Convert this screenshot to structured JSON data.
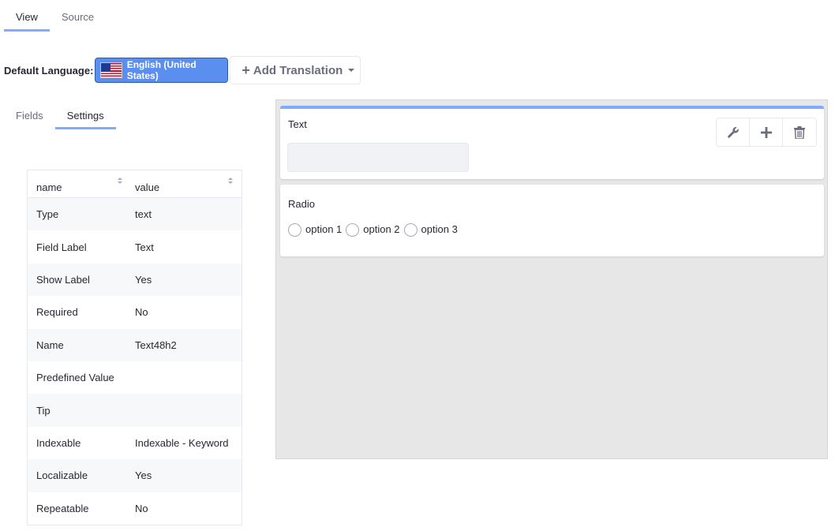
{
  "top_tabs": [
    {
      "label": "View",
      "active": true
    },
    {
      "label": "Source",
      "active": false
    }
  ],
  "language": {
    "label": "Default Language:",
    "current": "English (United States)",
    "flag_icon": "us-flag-icon",
    "add_translation_label": "Add Translation"
  },
  "sub_tabs": [
    {
      "label": "Fields",
      "active": false
    },
    {
      "label": "Settings",
      "active": true
    }
  ],
  "settings_table": {
    "headers": [
      "name",
      "value"
    ],
    "rows": [
      {
        "name": "Type",
        "value": "text"
      },
      {
        "name": "Field Label",
        "value": "Text"
      },
      {
        "name": "Show Label",
        "value": "Yes"
      },
      {
        "name": "Required",
        "value": "No"
      },
      {
        "name": "Name",
        "value": "Text48h2"
      },
      {
        "name": "Predefined Value",
        "value": ""
      },
      {
        "name": "Tip",
        "value": ""
      },
      {
        "name": "Indexable",
        "value": "Indexable - Keyword"
      },
      {
        "name": "Localizable",
        "value": "Yes"
      },
      {
        "name": "Repeatable",
        "value": "No"
      }
    ]
  },
  "canvas": {
    "text_field": {
      "label": "Text",
      "toolbar_icons": [
        "wrench-icon",
        "plus-icon",
        "trash-icon"
      ]
    },
    "radio_field": {
      "label": "Radio",
      "options": [
        "option 1",
        "option 2",
        "option 3"
      ]
    }
  },
  "colors": {
    "accent": "#80acff",
    "language_button": "#5a8ff0",
    "canvas_bg": "#e7e7e7"
  }
}
